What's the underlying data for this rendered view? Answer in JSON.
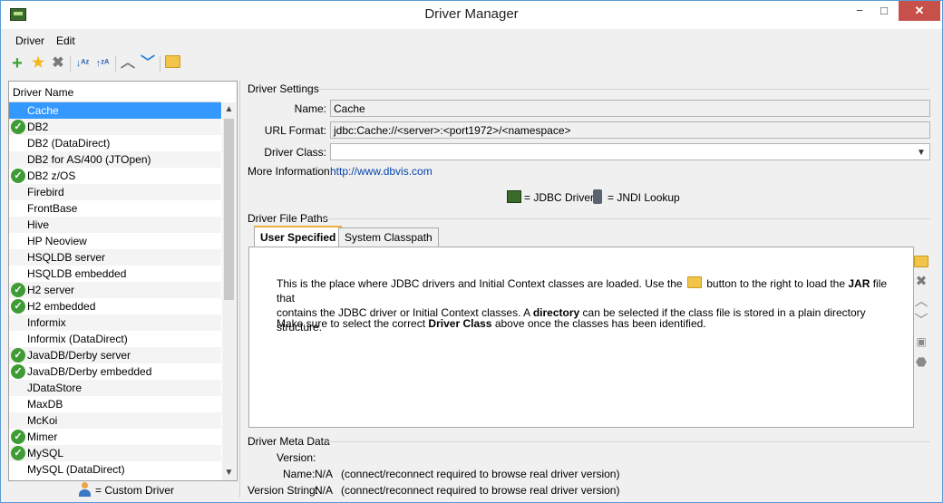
{
  "window": {
    "title": "Driver Manager",
    "minimize": "−",
    "maximize": "□",
    "close": "✕"
  },
  "menu": {
    "driver": "Driver",
    "edit": "Edit"
  },
  "toolbar": {
    "add_icon": "plus-icon",
    "favorite_icon": "star-icon",
    "delete_icon": "x-icon",
    "sort_az_icon": "sort-ascending-icon",
    "sort_za_icon": "sort-descending-icon",
    "up_icon": "chevron-up-icon",
    "down_icon": "chevron-down-icon",
    "folder_icon": "folder-icon"
  },
  "colors": {
    "selection": "#3399ff",
    "check": "#3f9c35",
    "link": "#0645ad",
    "tab_accent": "#f0b040",
    "close_button": "#c7504a"
  },
  "driver_list": {
    "header": "Driver Name",
    "items": [
      {
        "name": "Cache",
        "configured": false,
        "selected": true
      },
      {
        "name": "DB2",
        "configured": true
      },
      {
        "name": "DB2 (DataDirect)",
        "configured": false
      },
      {
        "name": "DB2 for AS/400 (JTOpen)",
        "configured": false
      },
      {
        "name": "DB2 z/OS",
        "configured": true
      },
      {
        "name": "Firebird",
        "configured": false
      },
      {
        "name": "FrontBase",
        "configured": false
      },
      {
        "name": "Hive",
        "configured": false
      },
      {
        "name": "HP Neoview",
        "configured": false
      },
      {
        "name": "HSQLDB server",
        "configured": false
      },
      {
        "name": "HSQLDB embedded",
        "configured": false
      },
      {
        "name": "H2 server",
        "configured": true
      },
      {
        "name": "H2 embedded",
        "configured": true
      },
      {
        "name": "Informix",
        "configured": false
      },
      {
        "name": "Informix (DataDirect)",
        "configured": false
      },
      {
        "name": "JavaDB/Derby server",
        "configured": true
      },
      {
        "name": "JavaDB/Derby embedded",
        "configured": true
      },
      {
        "name": "JDataStore",
        "configured": false
      },
      {
        "name": "MaxDB",
        "configured": false
      },
      {
        "name": "McKoi",
        "configured": false
      },
      {
        "name": "Mimer",
        "configured": true
      },
      {
        "name": "MySQL",
        "configured": true
      },
      {
        "name": "MySQL (DataDirect)",
        "configured": false
      }
    ],
    "custom_legend": "= Custom Driver"
  },
  "settings": {
    "section": "Driver Settings",
    "name_label": "Name:",
    "name_value": "Cache",
    "url_label": "URL Format:",
    "url_value": "jdbc:Cache://<server>:<port1972>/<namespace>",
    "class_label": "Driver Class:",
    "class_value": "",
    "more_label": "More Information:",
    "more_link": "http://www.dbvis.com",
    "legend_jdbc": "= JDBC Driver",
    "legend_jndi": "= JNDI Lookup"
  },
  "file_paths": {
    "section": "Driver File Paths",
    "tabs": [
      "User Specified",
      "System Classpath"
    ],
    "p1_a": "This is the place where JDBC drivers and Initial Context classes are loaded. Use the",
    "p1_b": "button to the right to load the",
    "p1_jar": "JAR",
    "p1_c": "file that",
    "p1_d": "contains the JDBC driver or Initial Context classes. A",
    "p1_dir": "directory",
    "p1_e": "can be selected if the class file is stored in a plain directory structure.",
    "p2_a": "Make sure to select the correct",
    "p2_b": "Driver Class",
    "p2_c": "above once the classes has been identified."
  },
  "meta": {
    "section": "Driver Meta Data",
    "version_label": "Version:",
    "name_label": "Name:",
    "name_value": "N/A",
    "name_note": "(connect/reconnect required to browse real driver version)",
    "vstring_label": "Version String:",
    "vstring_value": "N/A",
    "vstring_note": "(connect/reconnect required to browse real driver version)"
  }
}
